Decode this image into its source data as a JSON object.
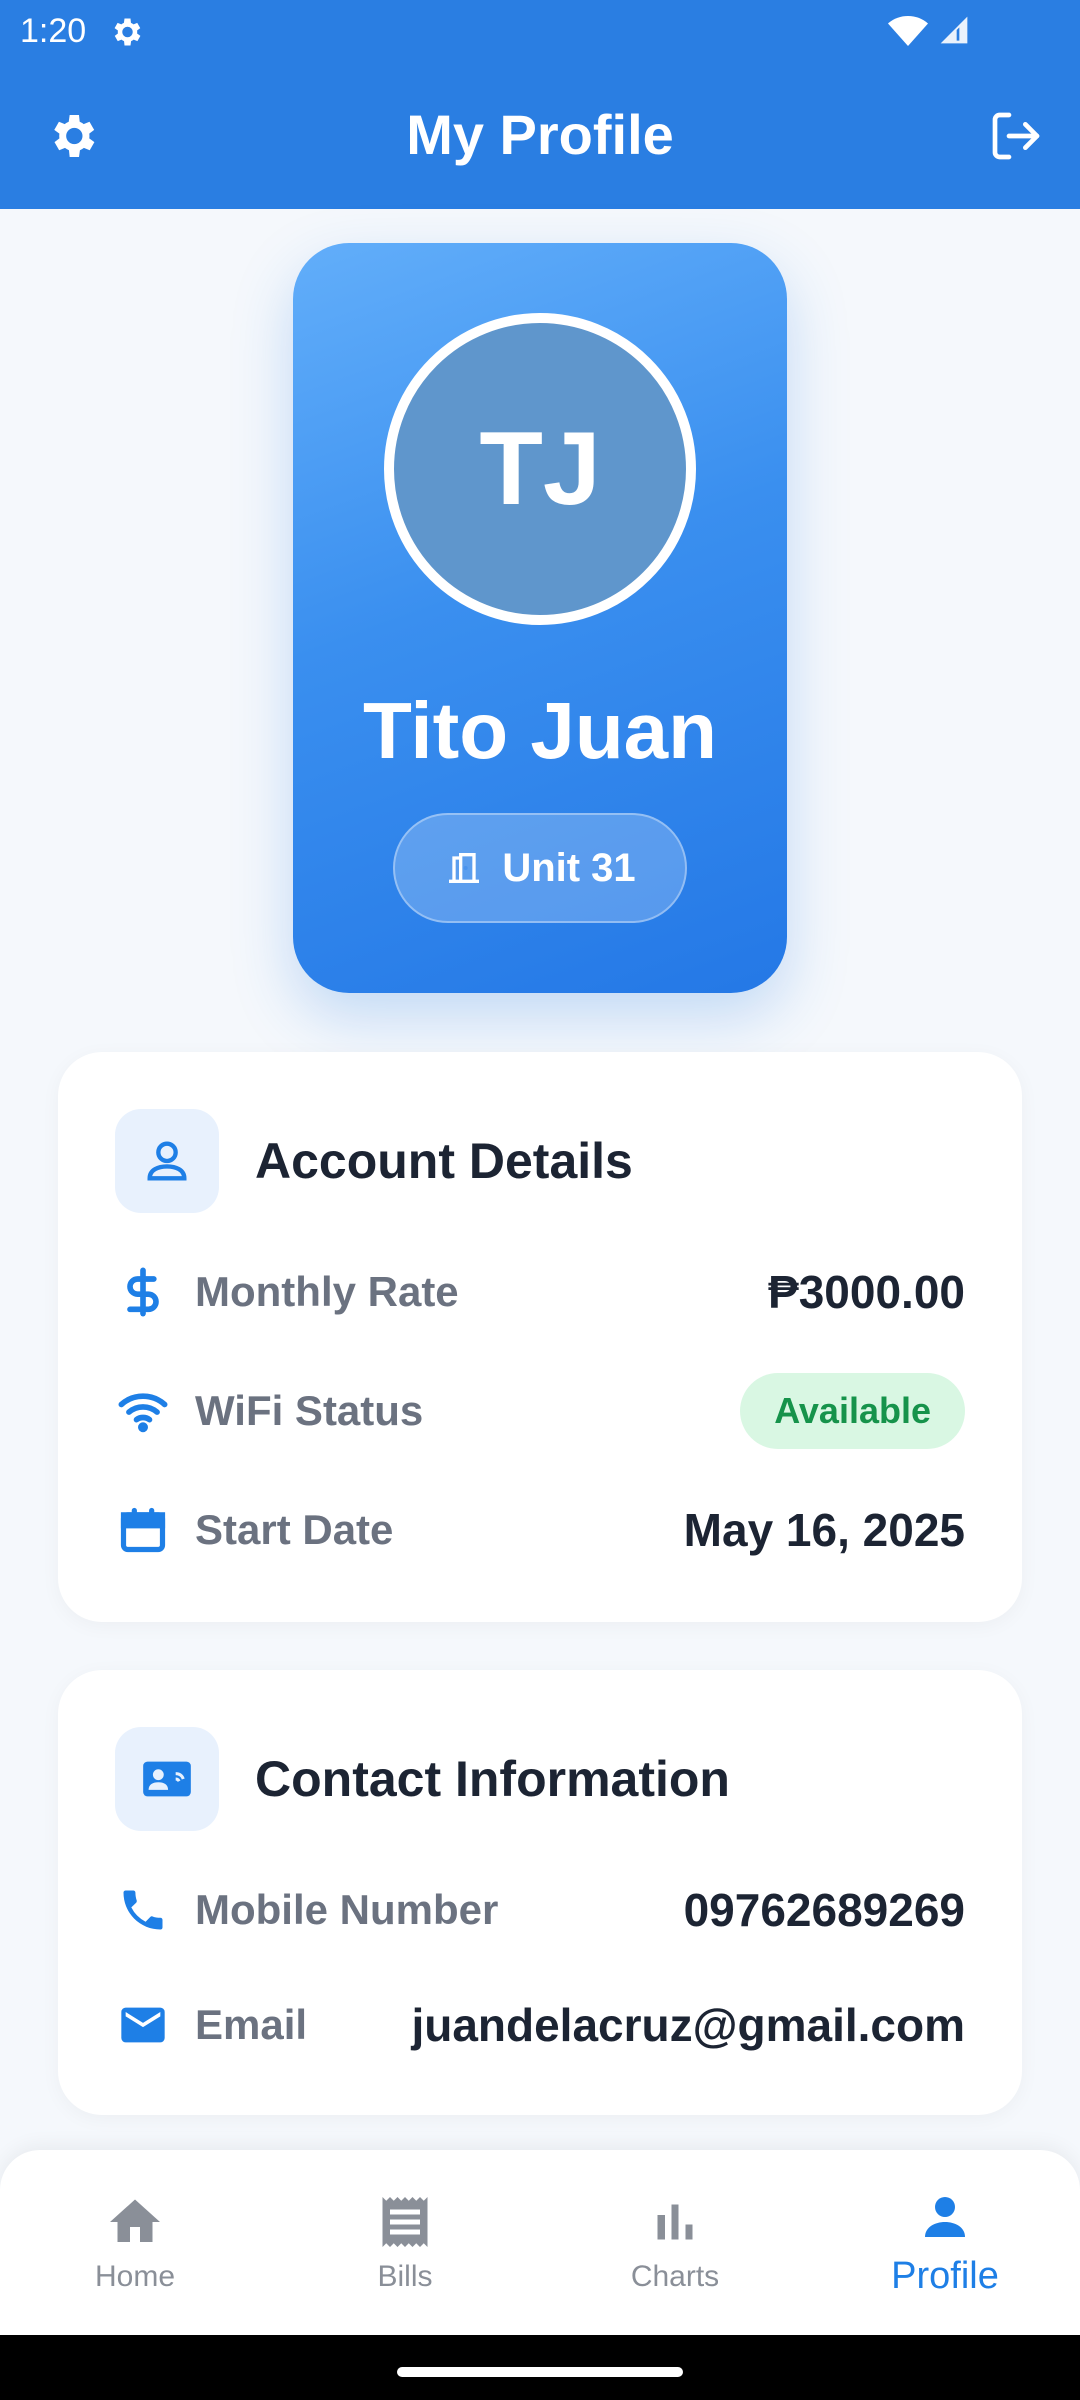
{
  "status_bar": {
    "time": "1:20"
  },
  "app_bar": {
    "title": "My Profile"
  },
  "profile": {
    "initials": "TJ",
    "name": "Tito Juan",
    "unit": "Unit 31"
  },
  "account_details": {
    "heading": "Account Details",
    "rows": [
      {
        "label": "Monthly Rate",
        "value": "₱3000.00",
        "icon": "dollar-icon"
      },
      {
        "label": "WiFi Status",
        "value": "Available",
        "icon": "wifi-icon"
      },
      {
        "label": "Start Date",
        "value": "May 16, 2025",
        "icon": "calendar-icon"
      }
    ]
  },
  "contact_information": {
    "heading": "Contact Information",
    "rows": [
      {
        "label": "Mobile Number",
        "value": "09762689269",
        "icon": "phone-icon"
      },
      {
        "label": "Email",
        "value": "juandelacruz@gmail.com",
        "icon": "mail-icon"
      }
    ]
  },
  "bottom_nav": {
    "items": [
      {
        "label": "Home",
        "icon": "home-icon"
      },
      {
        "label": "Bills",
        "icon": "receipt-icon"
      },
      {
        "label": "Charts",
        "icon": "bar-chart-icon"
      },
      {
        "label": "Profile",
        "icon": "person-icon",
        "active": true
      }
    ]
  },
  "colors": {
    "primary": "#2a7ee2",
    "success_bg": "#d9f7e3",
    "success_text": "#16934b"
  }
}
